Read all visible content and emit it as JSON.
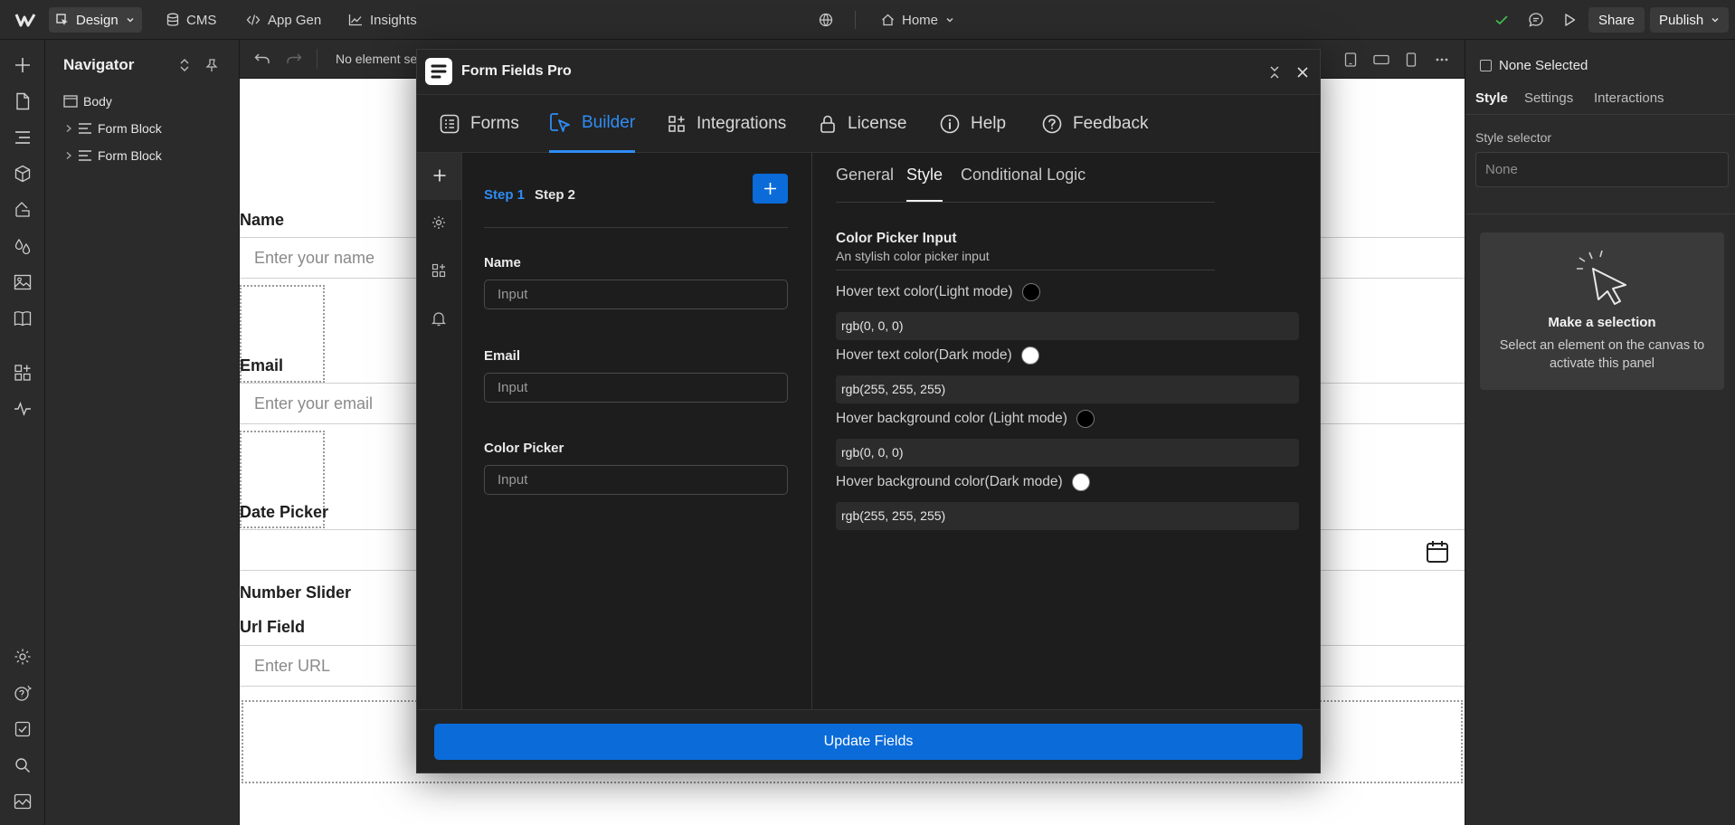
{
  "topbar": {
    "mode_label": "Design",
    "cms_label": "CMS",
    "appgen_label": "App Gen",
    "insights_label": "Insights",
    "page_label": "Home",
    "share_label": "Share",
    "publish_label": "Publish"
  },
  "navigator": {
    "title": "Navigator",
    "items": [
      {
        "label": "Body"
      },
      {
        "label": "Form Block"
      },
      {
        "label": "Form Block"
      }
    ]
  },
  "canvas_toolbar": {
    "selection_text": "No element se"
  },
  "canvas": {
    "name_label": "Name",
    "name_placeholder": "Enter your name",
    "email_label": "Email",
    "email_placeholder": "Enter your email",
    "date_label": "Date Picker",
    "slider_label": "Number Slider",
    "url_label": "Url Field",
    "url_placeholder": "Enter URL"
  },
  "modal": {
    "title": "Form Fields Pro",
    "tabs": [
      {
        "label": "Forms"
      },
      {
        "label": "Builder"
      },
      {
        "label": "Integrations"
      },
      {
        "label": "License"
      },
      {
        "label": "Help"
      },
      {
        "label": "Feedback"
      }
    ],
    "active_tab": "Builder",
    "steps": [
      {
        "label": "Step 1"
      },
      {
        "label": "Step 2"
      }
    ],
    "fields": [
      {
        "label": "Name",
        "placeholder": "Input"
      },
      {
        "label": "Email",
        "placeholder": "Input"
      },
      {
        "label": "Color Picker",
        "placeholder": "Input"
      }
    ],
    "style_tabs": [
      {
        "label": "General"
      },
      {
        "label": "Style"
      },
      {
        "label": "Conditional Logic"
      }
    ],
    "section_title": "Color Picker Input",
    "section_subtitle": "An stylish color picker input",
    "properties": [
      {
        "label": "Hover text color(Light mode)",
        "value": "rgb(0, 0, 0)",
        "swatch": "#000000"
      },
      {
        "label": "Hover text color(Dark mode)",
        "value": "rgb(255, 255, 255)",
        "swatch": "#ffffff"
      },
      {
        "label": "Hover background color (Light mode)",
        "value": "rgb(0, 0, 0)",
        "swatch": "#000000"
      },
      {
        "label": "Hover background color(Dark mode)",
        "value": "rgb(255, 255, 255)",
        "swatch": "#ffffff"
      }
    ],
    "update_label": "Update Fields"
  },
  "right_panel": {
    "none_selected": "None Selected",
    "tabs": [
      {
        "label": "Style"
      },
      {
        "label": "Settings"
      },
      {
        "label": "Interactions"
      }
    ],
    "selector_label": "Style selector",
    "selector_placeholder": "None",
    "empty_title": "Make a selection",
    "empty_text": "Select an element on the canvas to activate this panel"
  },
  "colors": {
    "accent": "#2f8cf5",
    "button_blue": "#0a6bd9",
    "success_check": "#3fb950"
  }
}
